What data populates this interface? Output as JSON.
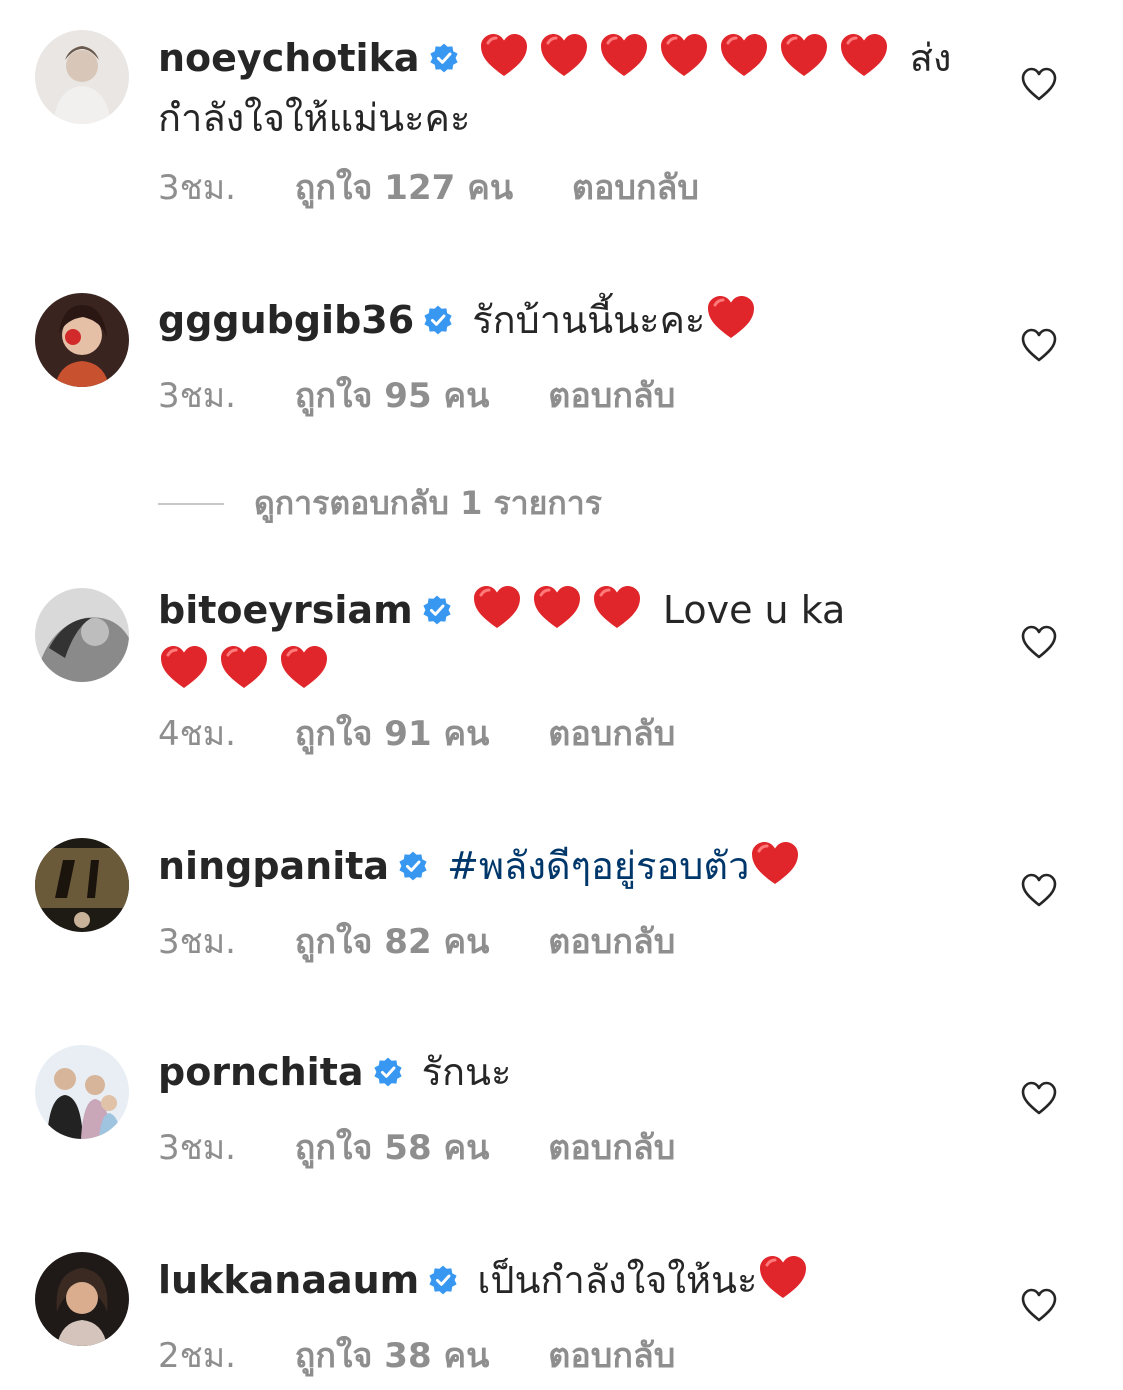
{
  "comments": [
    {
      "username": "noeychotika",
      "hearts_before": 7,
      "text": "ส่ง กำลังใจให้แม่นะคะ",
      "time": "3ชม.",
      "likes": "ถูกใจ 127 คน",
      "reply": "ตอบกลับ"
    },
    {
      "username": "gggubgib36",
      "text": "รักบ้านนี้นะคะ",
      "hearts_after": 1,
      "time": "3ชม.",
      "likes": "ถูกใจ 95 คน",
      "reply": "ตอบกลับ"
    },
    {
      "username": "bitoeyrsiam",
      "hearts_before": 3,
      "text": "Love u ka",
      "hearts_after": 3,
      "time": "4ชม.",
      "likes": "ถูกใจ 91 คน",
      "reply": "ตอบกลับ"
    },
    {
      "username": "ningpanita",
      "text": "#พลังดีๆอยู่รอบตัว",
      "hearts_after": 1,
      "time": "3ชม.",
      "likes": "ถูกใจ 82 คน",
      "reply": "ตอบกลับ"
    },
    {
      "username": "pornchita",
      "text": "รักนะ",
      "time": "3ชม.",
      "likes": "ถูกใจ 58 คน",
      "reply": "ตอบกลับ"
    },
    {
      "username": "lukkanaaum",
      "text": "เป็นกำลังใจให้นะ",
      "hearts_after": 1,
      "time": "2ชม.",
      "likes": "ถูกใจ 38 คน",
      "reply": "ตอบกลับ"
    }
  ],
  "view_replies": "ดูการตอบกลับ 1 รายการ",
  "colors": {
    "text": "#262626",
    "meta": "#8e8e8e",
    "verified": "#3897f0",
    "hashtag": "#00376b",
    "heart": "#e0262b"
  },
  "icons": {
    "verified": "verified-badge-icon",
    "like": "heart-outline-icon",
    "emoji": "red-heart-emoji"
  }
}
